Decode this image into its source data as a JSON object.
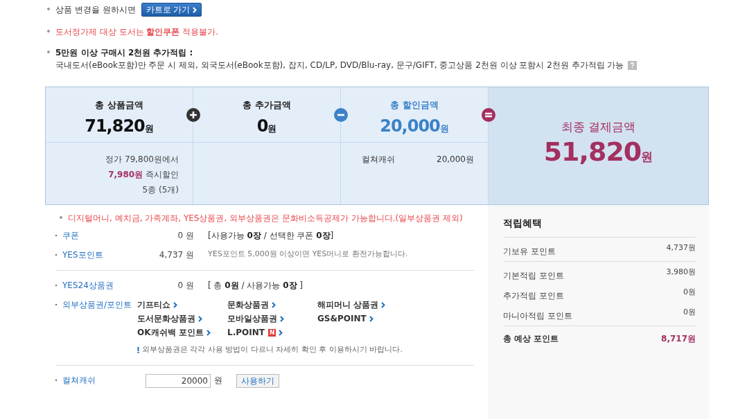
{
  "notes": [
    {
      "kind": "button_line",
      "text": "상품 변경을 원하시면",
      "button": "카트로 가기"
    },
    {
      "kind": "alert",
      "text": "도서정가제 대상 도서는 **할인쿠폰** 적용불가."
    },
    {
      "kind": "info",
      "title": "5만원 이상 구매시 2천원 추가적립 :",
      "text": "국내도서(eBook포함)만 주문 시 제외, 외국도서(eBook포함), 잡지, CD/LP, DVD/Blu-ray, 문구/GIFT, 중고상품 2천원 이상 포함시 2천원 추가적립 가능"
    }
  ],
  "summary": {
    "items": [
      {
        "label": "총 상품금액",
        "amount": "71,820",
        "unit": "원",
        "highlighted": false,
        "kind": "plus",
        "details": [
          {
            "kind": "line",
            "text": "정가 79,800원에서"
          },
          {
            "kind": "line",
            "text": "**7,980원** 즉시할인"
          },
          {
            "kind": "line",
            "text": "5종 (5개)"
          }
        ]
      },
      {
        "label": "총 추가금액",
        "amount": "0",
        "unit": "원",
        "highlighted": false,
        "kind": "minus"
      },
      {
        "label": "총 할인금액",
        "amount": "20,000",
        "unit": "원",
        "highlighted": true,
        "kind": "equals",
        "details": [
          {
            "kind": "pair",
            "label": "컬쳐캐쉬",
            "value": "20,000원"
          }
        ]
      }
    ],
    "final": {
      "label": "최종 결제금액",
      "amount": "51,820",
      "unit": "원"
    }
  },
  "payment": {
    "notice": "디지털머니, 예치금, 가족계좌, YES상품권, 외부상품권은 문화비소득공제가 가능합니다.(일부상품권 제외)",
    "groups": [
      [
        {
          "kind": "amount",
          "label": "쿠폰",
          "amount": "0 원",
          "note": "[사용가능 **0장** / 선택한 쿠폰 **0장**]"
        },
        {
          "kind": "amount",
          "label": "YES포인트",
          "amount": "4,737 원",
          "hint": "YES포인트 5,000원 이상이면 YES머니로 환전가능합니다."
        }
      ],
      [
        {
          "kind": "amount",
          "label": "YES24상품권",
          "amount": "0 원",
          "note": "[ 총 **0원** / 사용가능 **0장** ]"
        },
        {
          "kind": "links",
          "label": "외부상품권/포인트",
          "links": [
            {
              "text": "기프티쇼"
            },
            {
              "text": "문화상품권"
            },
            {
              "text": "해피머니 상품권"
            },
            {
              "text": "도서문화상품권"
            },
            {
              "text": "모바일상품권"
            },
            {
              "text": "GS&POINT"
            },
            {
              "text": "OK캐쉬백 포인트"
            },
            {
              "text": "L.POINT",
              "badge": "N"
            }
          ],
          "warning": "외부상품권은 각각 사용 방법이 다르니 자세히 확인 후 이용하시기 바랍니다."
        }
      ],
      [
        {
          "kind": "input",
          "label": "컬쳐캐쉬",
          "value": "20000",
          "unit": "원",
          "button": "사용하기"
        }
      ]
    ]
  },
  "rewards": {
    "title": "적립혜택",
    "groups": [
      [
        {
          "label": "기보유 포인트",
          "value": "4,737원"
        }
      ],
      [
        {
          "label": "기본적립 포인트",
          "value": "3,980원"
        },
        {
          "label": "추가적립 포인트",
          "value": "0원"
        },
        {
          "label": "마니아적립 포인트",
          "value": "0원"
        }
      ]
    ],
    "total": {
      "label": "총 예상 포인트",
      "value": "8,717원"
    }
  }
}
